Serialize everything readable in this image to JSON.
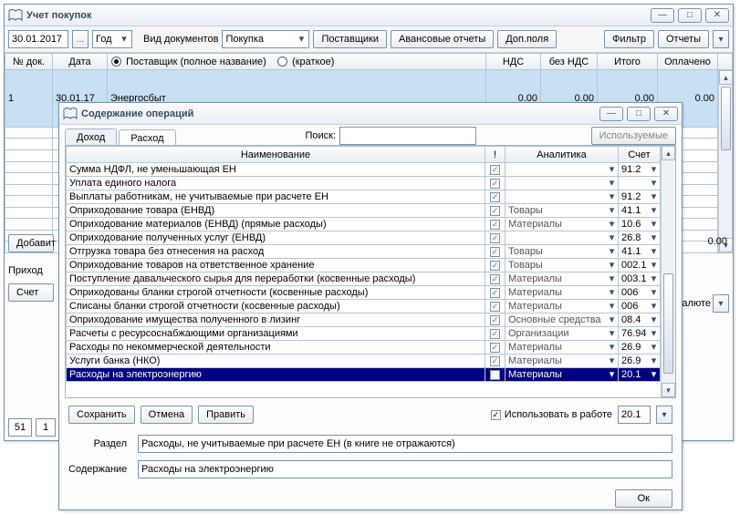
{
  "main_window": {
    "title": "Учет покупок",
    "toolbar": {
      "date": "30.01.2017",
      "date_ellipsis": "...",
      "period_label": "Год",
      "doc_type_label": "Вид документов",
      "doc_type_value": "Покупка",
      "suppliers_btn": "Поставщики",
      "advance_btn": "Авансовые отчеты",
      "extra_btn": "Доп.поля",
      "filter_btn": "Фильтр",
      "reports_btn": "Отчеты"
    },
    "headers": {
      "doc_no": "№ док.",
      "date": "Дата",
      "supplier_full": "Поставщик (полное название)",
      "supplier_short": "(краткое)",
      "vat": "НДС",
      "novat": "без НДС",
      "total": "Итого",
      "paid": "Оплачено"
    },
    "rows": [
      {
        "no": "1",
        "date": "30.01.17",
        "supplier": "Энергосбыт",
        "vat": "0.00",
        "novat": "0.00",
        "total": "0.00",
        "paid": "0.00"
      }
    ],
    "side": {
      "add_label": "Добавит",
      "income_label": "Приход",
      "account_label": "Счет",
      "currency_label": "валюте",
      "zero": "0.00"
    },
    "footer": {
      "page": "51",
      "total": "1"
    }
  },
  "dialog": {
    "title": "Содержание операций",
    "tabs": {
      "income": "Доход",
      "expense": "Расход"
    },
    "search_label": "Поиск:",
    "used_btn": "Используемые",
    "columns": {
      "name": "Наименование",
      "flag": "!",
      "analytics": "Аналитика",
      "account": "Счет"
    },
    "rows": [
      {
        "name": "Сумма НДФЛ, не уменьшающая ЕН",
        "analytics": "",
        "account": "91.2"
      },
      {
        "name": "Уплата единого налога",
        "analytics": "",
        "account": ""
      },
      {
        "name": "Выплаты работникам, не учитываемые при расчете ЕН",
        "analytics": "",
        "account": "91.2"
      },
      {
        "name": "Оприходование товара (ЕНВД)",
        "analytics": "Товары",
        "account": "41.1"
      },
      {
        "name": "Оприходование материалов (ЕНВД) (прямые расходы)",
        "analytics": "Материалы",
        "account": "10.6"
      },
      {
        "name": "Оприходование полученных услуг (ЕНВД)",
        "analytics": "",
        "account": "26.8"
      },
      {
        "name": "Отгрузка товара без отнесения на расход",
        "analytics": "Товары",
        "account": "41.1"
      },
      {
        "name": "Оприходование товаров на ответственное хранение",
        "analytics": "Товары",
        "account": "002.1"
      },
      {
        "name": "Поступление давальческого сырья для переработки (косвенные расходы)",
        "analytics": "Материалы",
        "account": "003.1"
      },
      {
        "name": "Оприходованы бланки строгой отчетности (косвенные расходы)",
        "analytics": "Материалы",
        "account": "006"
      },
      {
        "name": "Списаны бланки строгой отчетности (косвенные расходы)",
        "analytics": "Материалы",
        "account": "006"
      },
      {
        "name": "Оприходование имущества полученного в лизинг",
        "analytics": "Основные средства",
        "account": "08.4"
      },
      {
        "name": "Расчеты с ресурсоснабжающими организациями",
        "analytics": "Организации",
        "account": "76.94"
      },
      {
        "name": "Расходы по некоммерческой деятельности",
        "analytics": "Материалы",
        "account": "26.9"
      },
      {
        "name": "Услуги банка (НКО)",
        "analytics": "Материалы",
        "account": "26.9"
      },
      {
        "name": "Расходы на электроэнергию",
        "analytics": "Материалы",
        "account": "20.1",
        "highlight": true
      }
    ],
    "buttons": {
      "save": "Сохранить",
      "cancel": "Отмена",
      "edit": "Править",
      "ok": "Ок"
    },
    "use_in_work": "Использовать в работе",
    "use_in_work_checked": true,
    "account_value": "20.1",
    "section_label": "Раздел",
    "section_value": "Расходы, не учитываемые при расчете ЕН (в книге не отражаются)",
    "content_label": "Содержание",
    "content_value": "Расходы на электроэнергию"
  }
}
